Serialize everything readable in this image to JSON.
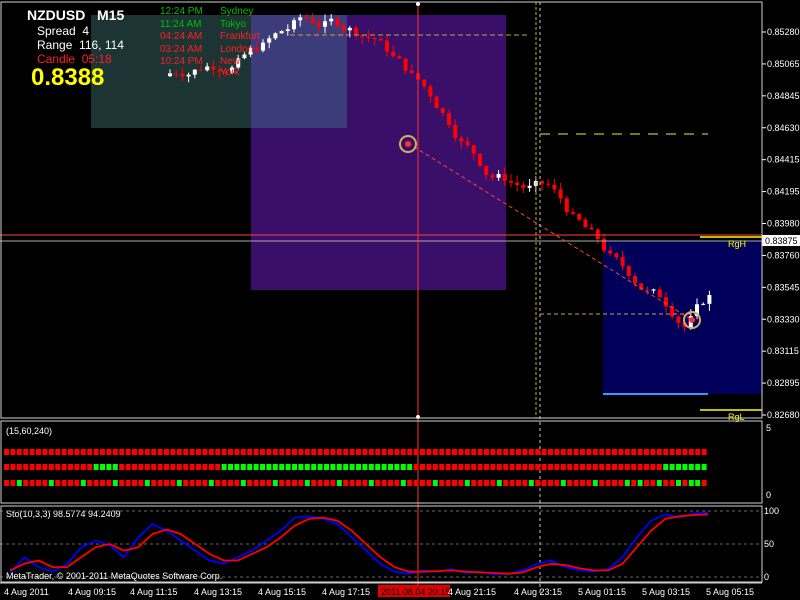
{
  "symbol": "NZDUSD",
  "timeframe": "M15",
  "spread_label": "Spread",
  "spread_value": "4",
  "range_label": "Range",
  "range_value": "116, 114",
  "candle_label": "Candle",
  "candle_value": "05:18",
  "current_price": "0.8388",
  "sessions": [
    {
      "time": "12:24 PM",
      "name": "Sydney",
      "color": "#00c000"
    },
    {
      "time": "11:24 AM",
      "name": "Tokyo",
      "color": "#00c000"
    },
    {
      "time": "04:24 AM",
      "name": "Frankfurt",
      "color": "#ff2020"
    },
    {
      "time": "03:24 AM",
      "name": "London",
      "color": "#ff2020"
    },
    {
      "time": "10:24 PM",
      "name": "New York",
      "color": "#ff2020"
    }
  ],
  "price_axis": [
    "0.85280",
    "0.85065",
    "0.84845",
    "0.84630",
    "0.84415",
    "0.84195",
    "0.83980",
    "0.83760",
    "0.83545",
    "0.83330",
    "0.83115",
    "0.82895",
    "0.82680"
  ],
  "price_tag": "0.83875",
  "label_rgh": "RgH",
  "label_rgl": "RgL",
  "indicator1_label": "(15,60,240)",
  "indicator1_axis": [
    "5",
    "0"
  ],
  "stoch_label": "Sto(10,3,3) 98.5774 94.2409",
  "stoch_axis": [
    "100",
    "50",
    "0"
  ],
  "copyright": "MetaTrader, © 2001-2011 MetaQuotes Software Corp.",
  "time_axis": [
    "4 Aug 2011",
    "4 Aug 09:15",
    "4 Aug 11:15",
    "4 Aug 13:15",
    "4 Aug 15:15",
    "4 Aug 17:15",
    "2011.08.04 20:15",
    "4 Aug 21:15",
    "4 Aug 23:15",
    "5 Aug 01:15",
    "5 Aug 03:15",
    "5 Aug 05:15"
  ],
  "colors": {
    "bull": "#ffffff",
    "bear": "#ff0000",
    "purple_box": "#3a0f6a",
    "blue_box": "#00005a",
    "dark_box": "#1c3434",
    "stoch_main": "#0000ff",
    "stoch_signal": "#ff0000",
    "dot_red": "#ff0000",
    "dot_green": "#00ff00",
    "level": "#ffff00"
  }
}
